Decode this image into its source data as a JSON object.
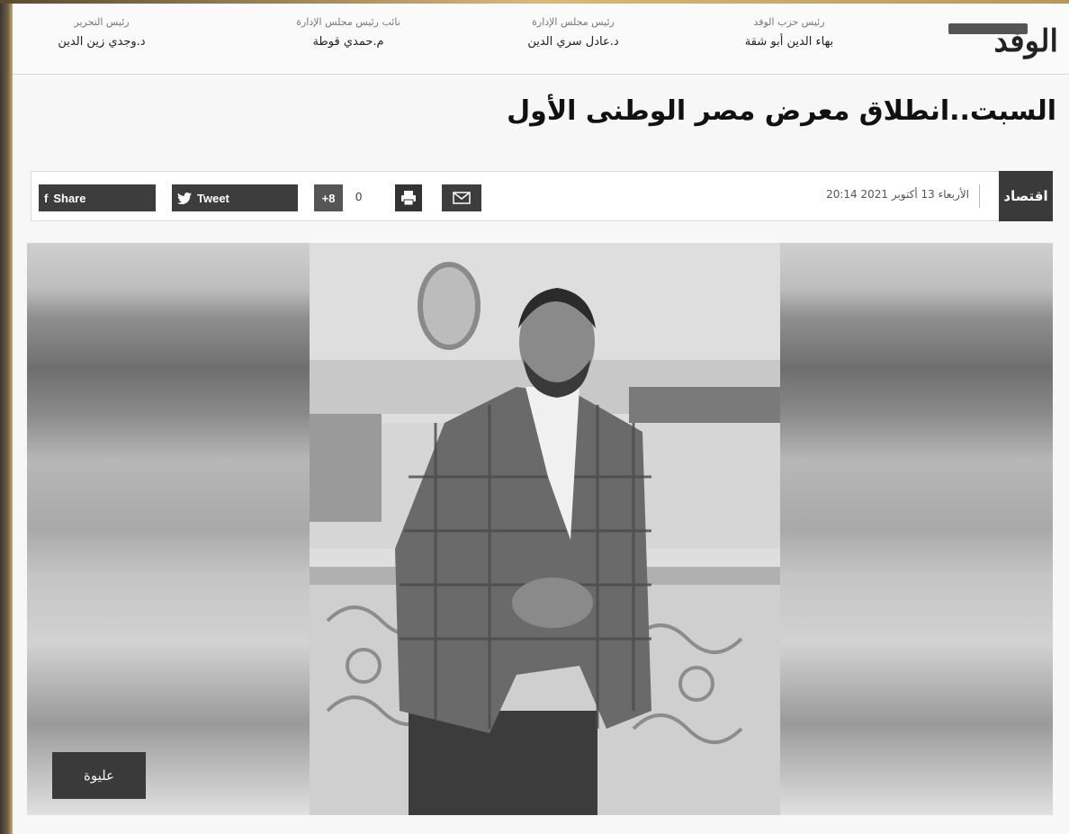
{
  "masthead": {
    "logo_text": "الوفد",
    "staff": [
      {
        "role": "رئيس حزب الوفد",
        "name": "بهاء الدين أبو شقة"
      },
      {
        "role": "رئيس مجلس الإدارة",
        "name": "د.عادل سري الدين"
      },
      {
        "role": "نائب رئيس مجلس الإدارة",
        "name": "م.حمدي قوطة"
      },
      {
        "role": "رئيس التحرير",
        "name": "د.وجدي زين الدين"
      }
    ]
  },
  "article": {
    "headline": "السبت..انطلاق معرض مصر الوطنى الأول",
    "section": "اقتصاد",
    "date": "الأربعاء 13 أكتوبر 2021 20:14"
  },
  "share": {
    "facebook_label": "Share",
    "facebook_glyph": "f",
    "twitter_label": "Tweet",
    "gplus_label": "8+",
    "gplus_count": "0"
  },
  "image": {
    "caption": "عليوة"
  },
  "icons": [
    "facebook-icon",
    "twitter-icon",
    "google-plus-icon",
    "print-icon",
    "mail-icon"
  ],
  "colors": {
    "toolbar_button": "#3d3d3d",
    "section_tab": "#3a3a3a",
    "frame_gold": "#d9b878"
  }
}
